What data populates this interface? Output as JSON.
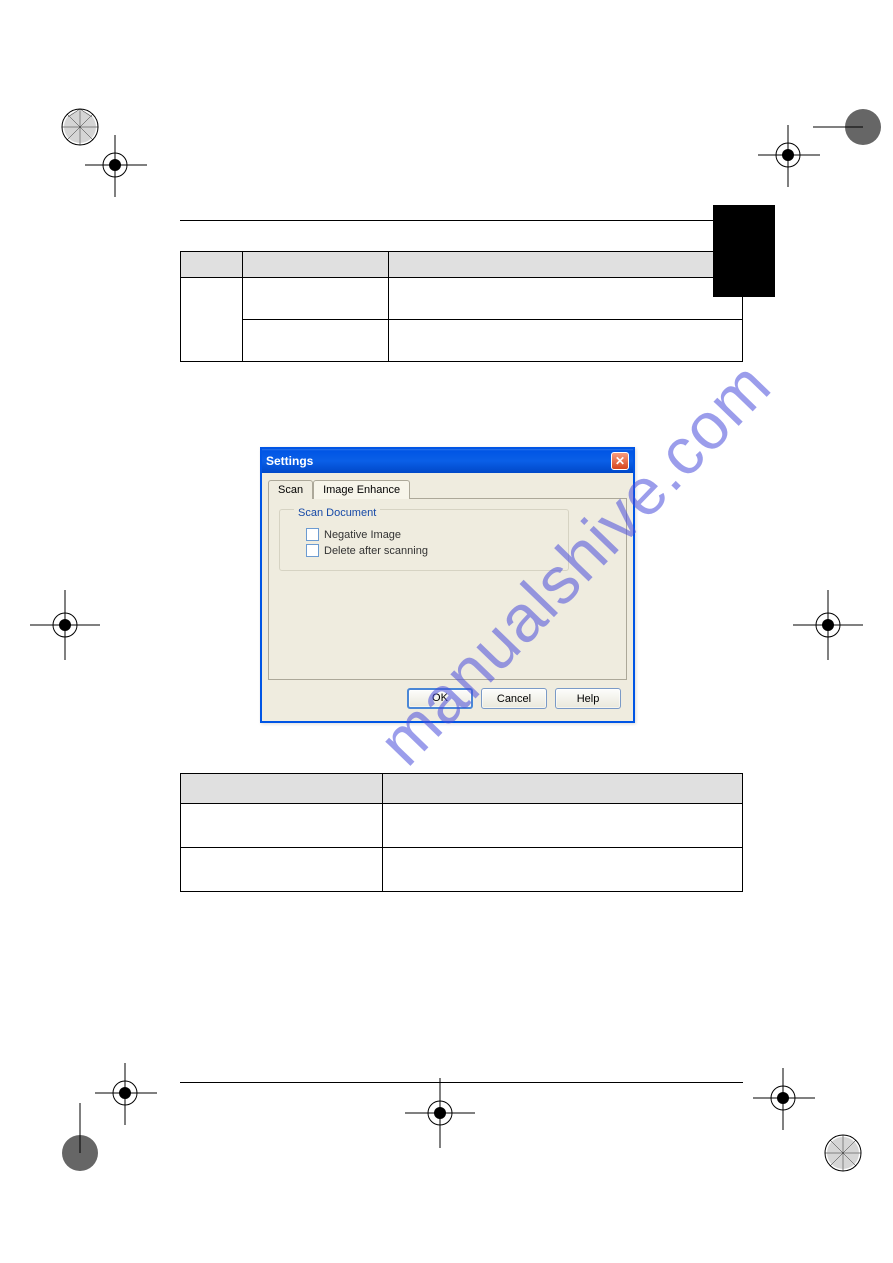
{
  "watermark": "manualshive.com",
  "dialog": {
    "title": "Settings",
    "tabs": {
      "scan": "Scan",
      "enhance": "Image Enhance"
    },
    "group_legend": "Scan Document",
    "checkbox1": "Negative Image",
    "checkbox2": "Delete after scanning",
    "buttons": {
      "ok": "OK",
      "cancel": "Cancel",
      "help": "Help"
    }
  }
}
